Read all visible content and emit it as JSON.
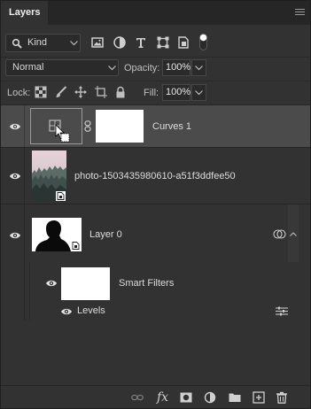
{
  "panel": {
    "tab_label": "Layers",
    "menu_icon": "hamburger-menu-icon"
  },
  "filter": {
    "kind_label": "Kind",
    "filter_icons": [
      "pixel-layer-filter-icon",
      "adjustment-layer-filter-icon",
      "type-layer-filter-icon",
      "shape-layer-filter-icon",
      "smart-object-filter-icon"
    ],
    "toggle_on": true
  },
  "blend": {
    "mode": "Normal",
    "opacity_label": "Opacity:",
    "opacity_value": "100%"
  },
  "lock": {
    "label": "Lock:",
    "icons": [
      "lock-transparent-pixels-icon",
      "lock-image-pixels-icon",
      "lock-position-icon",
      "lock-artboard-icon",
      "lock-all-icon"
    ],
    "fill_label": "Fill:",
    "fill_value": "100%"
  },
  "layers": [
    {
      "name": "Curves 1",
      "visible": true,
      "selected": true,
      "type": "adjustment"
    },
    {
      "name": "photo-1503435980610-a51f3ddfee50",
      "visible": true,
      "selected": false,
      "type": "smart-object"
    },
    {
      "name": "Layer 0",
      "visible": true,
      "selected": false,
      "type": "smart-object",
      "expanded": true
    }
  ],
  "smart_filters": {
    "label": "Smart Filters",
    "visible": true,
    "filter_name": "Levels",
    "filter_visible": true
  },
  "footer_icons": [
    "link-layers-icon",
    "fx-icon",
    "add-mask-icon",
    "new-adjustment-layer-icon",
    "new-group-icon",
    "new-layer-icon",
    "delete-layer-icon"
  ],
  "footer_fx_label": "fx",
  "colors": {
    "panel_bg": "#323232",
    "selected_row": "#4b4b4b",
    "text": "#dcdcdc"
  }
}
